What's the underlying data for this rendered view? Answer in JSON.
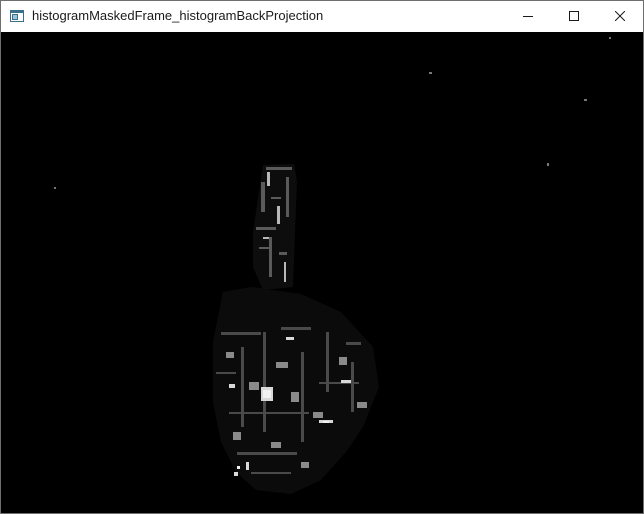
{
  "window": {
    "title": "histogramMaskedFrame_histogramBackProjection"
  },
  "controls": {
    "minimize_icon": "minimize-icon",
    "maximize_icon": "maximize-icon",
    "close_icon": "close-icon"
  },
  "image": {
    "description_icon": "back-projection-image",
    "background_color": "#000000"
  }
}
